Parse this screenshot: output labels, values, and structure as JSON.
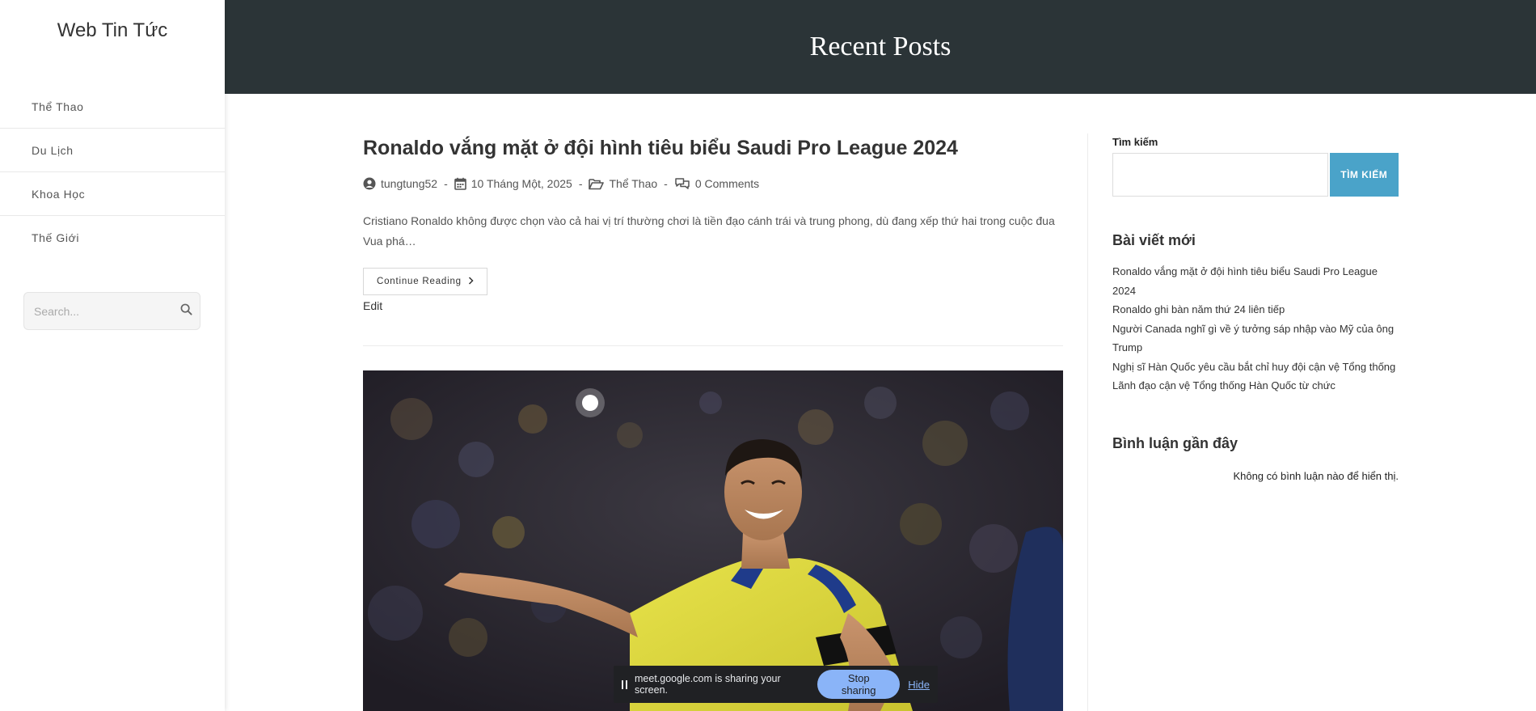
{
  "site": {
    "title": "Web Tin Tức"
  },
  "nav": {
    "items": [
      {
        "label": "Thể Thao"
      },
      {
        "label": "Du Lịch"
      },
      {
        "label": "Khoa Học"
      },
      {
        "label": "Thế Giới"
      }
    ]
  },
  "left_search": {
    "placeholder": "Search..."
  },
  "hero": {
    "title": "Recent Posts"
  },
  "post": {
    "title": "Ronaldo vắng mặt ở đội hình tiêu biểu Saudi Pro League 2024",
    "author": "tungtung52",
    "date": "10 Tháng Một, 2025",
    "category": "Thể Thao",
    "comments": "0 Comments",
    "separator": "-",
    "excerpt": "Cristiano Ronaldo không được chọn vào cả hai vị trí thường chơi là tiền đạo cánh trái và trung phong, dù đang xếp thứ hai trong cuộc đua Vua phá…",
    "continue_label": "Continue Reading",
    "edit_label": "Edit"
  },
  "sidebar": {
    "search_label": "Tìm kiếm",
    "search_value": "",
    "search_button": "TÌM KIẾM",
    "recent_title": "Bài viết mới",
    "recent_posts": [
      "Ronaldo vắng mặt ở đội hình tiêu biểu Saudi Pro League 2024",
      "Ronaldo ghi bàn năm thứ 24 liên tiếp",
      "Người Canada nghĩ gì về ý tưởng sáp nhập vào Mỹ của ông Trump",
      "Nghị sĩ Hàn Quốc yêu cầu bắt chỉ huy đội cận vệ Tổng thống",
      "Lãnh đạo cận vệ Tổng thống Hàn Quốc từ chức"
    ],
    "comments_title": "Bình luận gần đây",
    "no_comments": "Không có bình luận nào để hiển thị."
  },
  "share_bar": {
    "message": "meet.google.com is sharing your screen.",
    "stop_label": "Stop sharing",
    "hide_label": "Hide"
  },
  "colors": {
    "hero_bg": "#2b3437",
    "search_button_bg": "#4aa3c9",
    "share_bar_bg": "#202124",
    "stop_button_bg": "#8ab4f8"
  }
}
